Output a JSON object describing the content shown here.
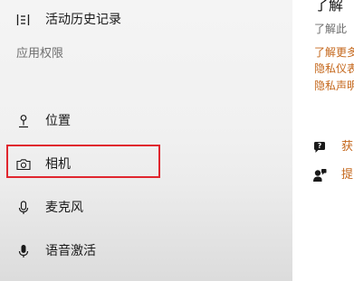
{
  "sidebar": {
    "items": [
      {
        "label": "活动历史记录",
        "icon": "activity-history-icon"
      },
      {
        "label": "位置",
        "icon": "location-icon"
      },
      {
        "label": "相机",
        "icon": "camera-icon"
      },
      {
        "label": "麦克风",
        "icon": "microphone-icon"
      },
      {
        "label": "语音激活",
        "icon": "voice-activation-icon"
      }
    ],
    "section_header": "应用权限",
    "highlight_color": "#e0262e"
  },
  "content": {
    "heading": "了解",
    "subtext": "了解此",
    "links": [
      "了解更多",
      "隐私仪表",
      "隐私声明"
    ],
    "actions": [
      {
        "label": "获",
        "icon": "get-help-icon"
      },
      {
        "label": "提",
        "icon": "give-feedback-icon"
      }
    ],
    "link_color": "#c4661a"
  }
}
